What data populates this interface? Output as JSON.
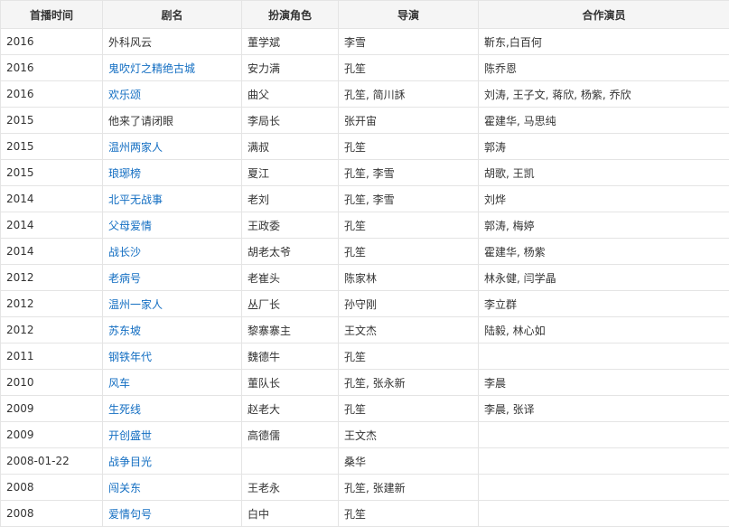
{
  "headers": [
    "首播时间",
    "剧名",
    "扮演角色",
    "导演",
    "合作演员"
  ],
  "colors": {
    "link": "#136ec2",
    "text": "#333333",
    "header_bg": "#f5f5f5",
    "border": "#e4e4e4"
  },
  "rows": [
    {
      "year": "2016",
      "title": "外科风云",
      "title_link": false,
      "role": "董学斌",
      "director": "李雪",
      "costars": "靳东,白百何"
    },
    {
      "year": "2016",
      "title": "鬼吹灯之精绝古城",
      "title_link": true,
      "role": "安力满",
      "director": "孔笙",
      "costars": "陈乔恩"
    },
    {
      "year": "2016",
      "title": "欢乐颂",
      "title_link": true,
      "role": "曲父",
      "director": "孔笙, 简川訸",
      "costars": "刘涛, 王子文, 蒋欣, 杨紫, 乔欣"
    },
    {
      "year": "2015",
      "title": "他来了请闭眼",
      "title_link": false,
      "role": "李局长",
      "director": "张开宙",
      "costars": "霍建华, 马思纯"
    },
    {
      "year": "2015",
      "title": "温州两家人",
      "title_link": true,
      "role": "满叔",
      "director": "孔笙",
      "costars": "郭涛"
    },
    {
      "year": "2015",
      "title": "琅琊榜",
      "title_link": true,
      "role": "夏江",
      "director": "孔笙, 李雪",
      "costars": "胡歌, 王凯"
    },
    {
      "year": "2014",
      "title": "北平无战事",
      "title_link": true,
      "role": "老刘",
      "director": "孔笙, 李雪",
      "costars": "刘烨"
    },
    {
      "year": "2014",
      "title": "父母爱情",
      "title_link": true,
      "role": "王政委",
      "director": "孔笙",
      "costars": "郭涛, 梅婷"
    },
    {
      "year": "2014",
      "title": "战长沙",
      "title_link": true,
      "role": "胡老太爷",
      "director": "孔笙",
      "costars": "霍建华, 杨紫"
    },
    {
      "year": "2012",
      "title": "老病号",
      "title_link": true,
      "role": "老崔头",
      "director": "陈家林",
      "costars": "林永健, 闫学晶"
    },
    {
      "year": "2012",
      "title": "温州一家人",
      "title_link": true,
      "role": "丛厂长",
      "director": "孙守刚",
      "costars": "李立群"
    },
    {
      "year": "2012",
      "title": "苏东坡",
      "title_link": true,
      "role": "黎寨寨主",
      "director": "王文杰",
      "costars": "陆毅, 林心如"
    },
    {
      "year": "2011",
      "title": "钢铁年代",
      "title_link": true,
      "role": "魏德牛",
      "director": "孔笙",
      "costars": ""
    },
    {
      "year": "2010",
      "title": "风车",
      "title_link": true,
      "role": "董队长",
      "director": "孔笙, 张永新",
      "costars": "李晨"
    },
    {
      "year": "2009",
      "title": "生死线",
      "title_link": true,
      "role": "赵老大",
      "director": "孔笙",
      "costars": "李晨, 张译"
    },
    {
      "year": "2009",
      "title": "开创盛世",
      "title_link": true,
      "role": "高德儒",
      "director": "王文杰",
      "costars": ""
    },
    {
      "year": "2008-01-22",
      "title": "战争目光",
      "title_link": true,
      "role": "",
      "director": "桑华",
      "costars": ""
    },
    {
      "year": "2008",
      "title": "闯关东",
      "title_link": true,
      "role": "王老永",
      "director": "孔笙, 张建新",
      "costars": ""
    },
    {
      "year": "2008",
      "title": "爱情句号",
      "title_link": true,
      "role": "白中",
      "director": "孔笙",
      "costars": ""
    }
  ]
}
